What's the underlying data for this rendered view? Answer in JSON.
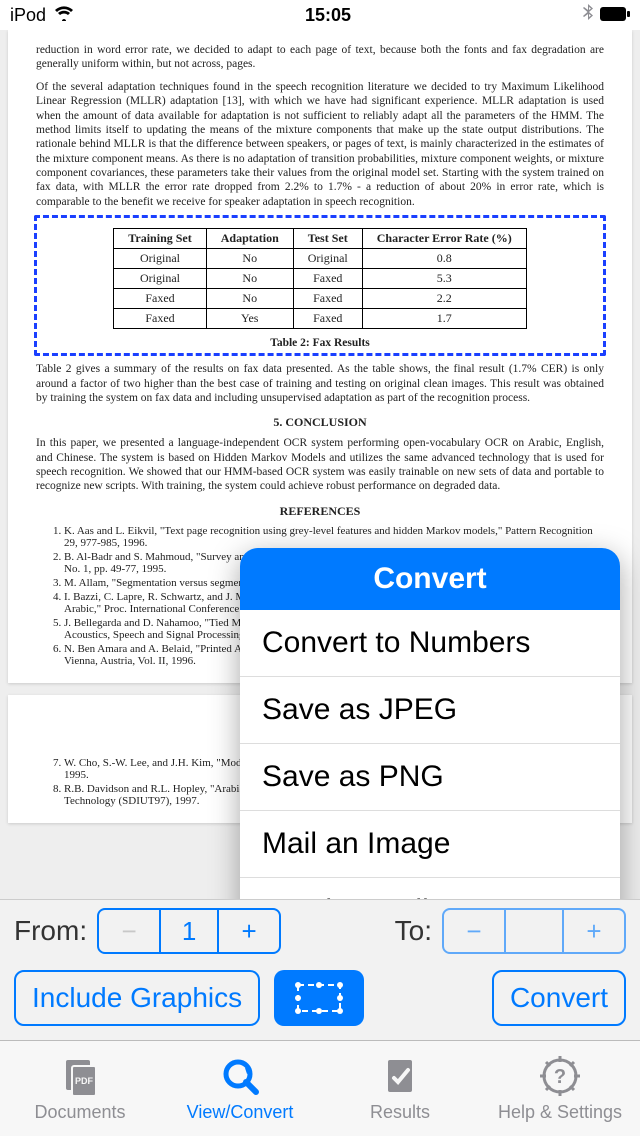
{
  "status": {
    "device": "iPod",
    "time": "15:05"
  },
  "document": {
    "para_frag1": "reduction in word error rate, we decided to adapt to each page of text, because both the fonts and fax degradation are generally uniform within, but not across, pages.",
    "para_mllr": "Of the several adaptation techniques found in the speech recognition literature we decided to try Maximum Likelihood Linear Regression (MLLR) adaptation [13], with which we have had significant experience. MLLR adaptation is used when the amount of data available for adaptation is not sufficient to reliably adapt all the parameters of the HMM. The method limits itself to updating the means of the mixture components that make up the state output distributions. The rationale behind MLLR is that the difference between speakers, or pages of text, is mainly characterized in the estimates of the mixture component means. As there is no adaptation of transition probabilities, mixture component weights, or mixture component covariances, these parameters take their values from the original model set. Starting with the system trained on fax data, with MLLR the error rate dropped from 2.2% to 1.7% - a reduction of about 20% in error rate, which is comparable to the benefit we receive for speaker adaptation in speech recognition.",
    "table_caption": "Table 2:  Fax Results",
    "table": {
      "headers": [
        "Training Set",
        "Adaptation",
        "Test Set",
        "Character Error Rate (%)"
      ],
      "rows": [
        [
          "Original",
          "No",
          "Original",
          "0.8"
        ],
        [
          "Original",
          "No",
          "Faxed",
          "5.3"
        ],
        [
          "Faxed",
          "No",
          "Faxed",
          "2.2"
        ],
        [
          "Faxed",
          "Yes",
          "Faxed",
          "1.7"
        ]
      ]
    },
    "para_t2": "Table 2 gives a summary of the results on fax data presented. As the table shows, the final result (1.7% CER) is only around a factor of two higher than the best case of training and testing on original clean images. This result was obtained by training the system on fax data and including unsupervised adaptation as part of the recognition process.",
    "h_conclusion": "5. CONCLUSION",
    "para_conc": "In this paper, we presented a language-independent OCR system performing open-vocabulary OCR on Arabic, English, and Chinese. The system is based on Hidden Markov Models and utilizes the same advanced technology that is used for speech recognition. We showed that our HMM-based OCR system was easily trainable on new sets of data and portable to recognize new scripts. With training, the system could achieve robust performance on degraded data.",
    "h_refs": "REFERENCES",
    "refs": [
      "K. Aas and L. Eikvil, \"Text page recognition using grey-level features and hidden Markov models,\" Pattern Recognition 29, 977-985, 1996.",
      "B. Al-Badr and S. Mahmoud, \"Survey and bibliography of Arabic optical text recognition,\" Signal Processing, Vol. 41, No. 1, pp. 49-77, 1995.",
      "M. Allam, \"Segmentation versus segmentation-free for recognizing Arabic text,\" SPIE Vol. 2422, 228-235, 1995.",
      "I. Bazzi, C. Lapre, R. Schwartz, and J. Makhoul, \"Omnifont and Open-Vocabulary Character Recognition of English and Arabic,\" Proc. International Conference on Document Analysis and Recognition, 1997.",
      "J. Bellegarda and D. Nahamoo, \"Tied Mixture Continuous Parameter Modeling for Speech Recognition,\" IEEE Int. Conf. Acoustics, Speech and Signal Processing, 1990.",
      "N. Ben Amara and A. Belaid, \"Printed Arabic Character Recognition,\" Workshop on Document Analysis and Recognition, Vienna, Austria, Vol. II, 1996."
    ],
    "refs2": [
      "W. Cho, S.-W. Lee, and J.H. Kim, \"Modeling and Recognition of Cursive Words,\" Pattern Recognition 28, 1941-1953, 1995.",
      "R.B. Davidson and R.L. Hopley, \"Arabic and Persian OCR Training,\" Symposium on Document Image Understanding Technology (SDIUT97), 1997."
    ]
  },
  "controls": {
    "from_label": "From:",
    "from_value": "1",
    "to_label": "To:",
    "include_graphics": "Include Graphics",
    "convert": "Convert"
  },
  "tabs": {
    "documents": "Documents",
    "view": "View/Convert",
    "results": "Results",
    "help": "Help & Settings"
  },
  "popover": {
    "title": "Convert",
    "items": [
      "Convert to Numbers",
      "Save as JPEG",
      "Save as PNG",
      "Mail an Image",
      "Send to Mail"
    ]
  }
}
